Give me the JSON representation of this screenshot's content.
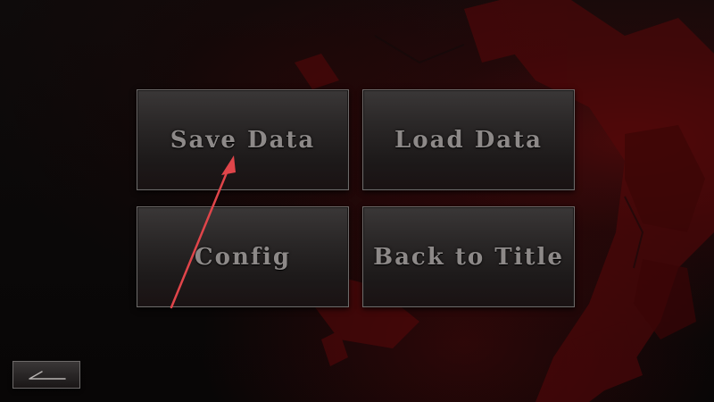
{
  "menu": {
    "save_label": "Save Data",
    "load_label": "Load Data",
    "config_label": "Config",
    "title_label": "Back to Title"
  },
  "back_button": {
    "icon": "back-arrow-icon"
  },
  "colors": {
    "background": "#0b0909",
    "blood_red": "#7a0a0c",
    "button_border": "#6d6a69",
    "button_text": "#8d8988",
    "annotation_arrow": "#e0454a"
  }
}
